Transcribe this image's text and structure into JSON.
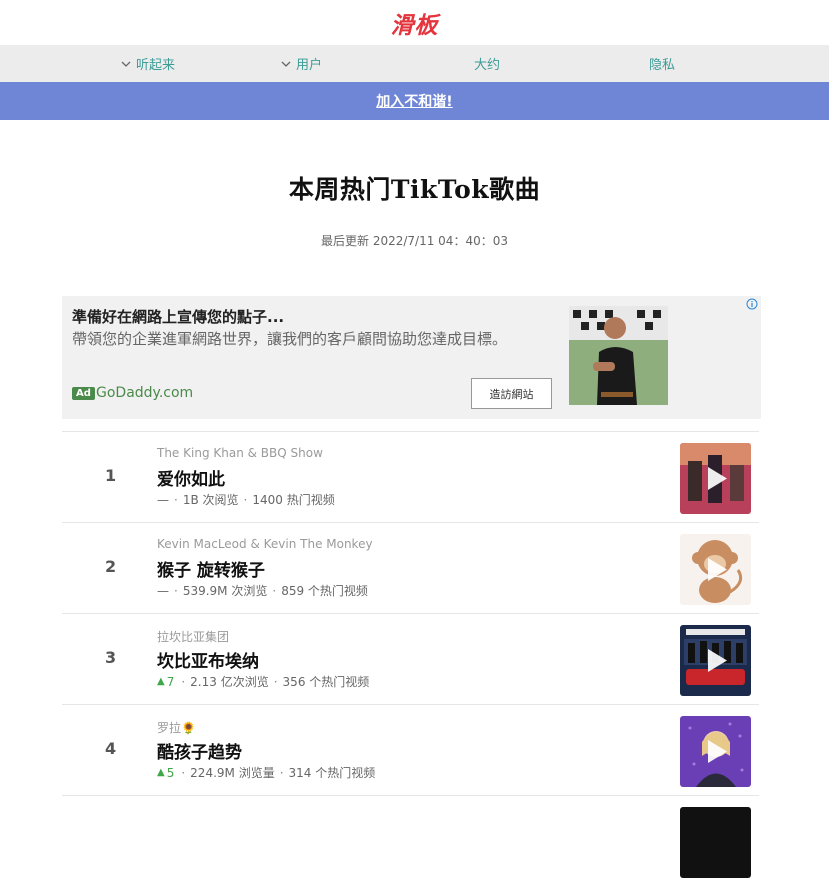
{
  "logo": "滑板",
  "nav": [
    {
      "label": "听起来",
      "has_dropdown": true
    },
    {
      "label": "用户",
      "has_dropdown": true
    },
    {
      "label": "大约",
      "has_dropdown": false
    },
    {
      "label": "隐私",
      "has_dropdown": false
    }
  ],
  "banner": {
    "label": "加入不和谐!"
  },
  "page_title": "本周热门TikTok歌曲",
  "updated": "最后更新 2022/7/11 04：40：03",
  "ad": {
    "title": "準備好在網路上宣傳您的點子...",
    "body": "帶領您的企業進軍網路世界，讓我們的客戶顧問協助您達成目標。",
    "badge": "Ad",
    "domain": "GoDaddy.com",
    "button": "造訪網站"
  },
  "songs": [
    {
      "rank": "1",
      "artist": "The King Khan & BBQ Show",
      "title": "爱你如此",
      "change": "—",
      "change_dir": "none",
      "views": "1B 次阅览",
      "videos": "1400 热门视频",
      "thumb_color": "#b8405a"
    },
    {
      "rank": "2",
      "artist": "Kevin MacLeod & Kevin The Monkey",
      "title": "猴子 旋转猴子",
      "change": "—",
      "change_dir": "none",
      "views": "539.9M 次浏览",
      "videos": "859 个热门视频",
      "thumb_color": "#c98d62"
    },
    {
      "rank": "3",
      "artist": "拉坎比亚集团",
      "title": "坎比亚布埃纳",
      "change": "7",
      "change_dir": "up",
      "views": "2.13 亿次浏览",
      "videos": "356 个热门视频",
      "thumb_color": "#1b2a4a"
    },
    {
      "rank": "4",
      "artist": "罗拉🌻",
      "title": "酷孩子趋势",
      "change": "5",
      "change_dir": "up",
      "views": "224.9M 浏览量",
      "videos": "314 个热门视频",
      "thumb_color": "#6a3fb5"
    }
  ],
  "colors": {
    "accent": "#3c9c96",
    "banner": "#6f86d6",
    "logo": "#e4343d",
    "up": "#3fa64a"
  }
}
